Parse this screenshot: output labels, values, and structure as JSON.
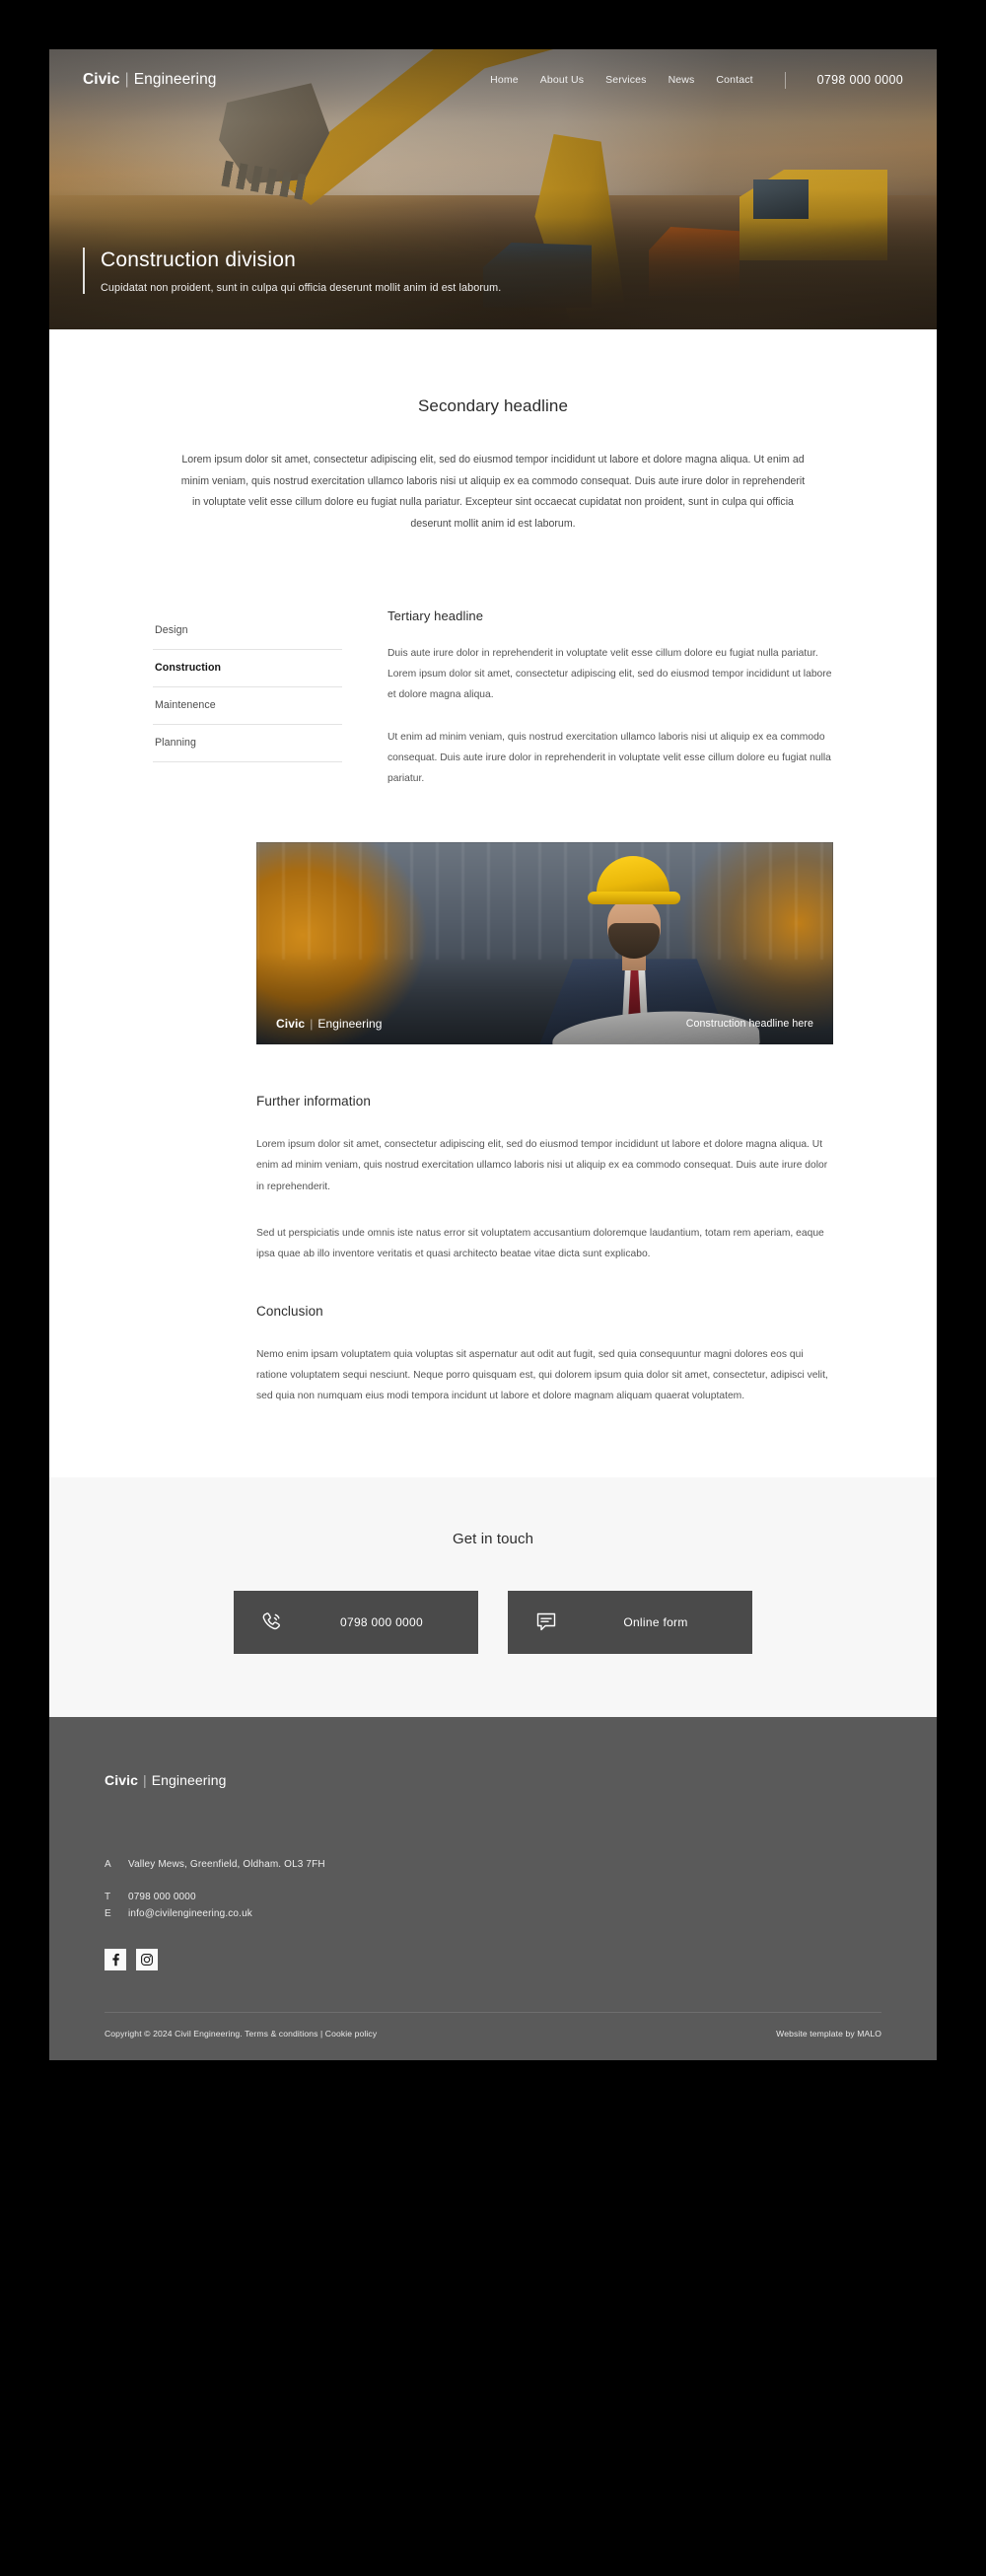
{
  "brand": {
    "first": "Civic",
    "divider": "|",
    "second": "Engineering"
  },
  "nav": {
    "items": [
      {
        "label": "Home"
      },
      {
        "label": "About Us"
      },
      {
        "label": "Services"
      },
      {
        "label": "News"
      },
      {
        "label": "Contact"
      }
    ],
    "phone": "0798 000 0000"
  },
  "hero": {
    "title": "Construction division",
    "subtitle": "Cupidatat non proident, sunt in culpa qui officia deserunt mollit anim id est laborum."
  },
  "secondary": {
    "headline": "Secondary headline",
    "intro": "Lorem ipsum dolor sit amet, consectetur adipiscing elit, sed do eiusmod tempor incididunt ut labore et dolore magna aliqua. Ut enim ad minim veniam, quis nostrud exercitation ullamco laboris nisi ut aliquip ex ea commodo consequat. Duis aute irure dolor in reprehenderit in voluptate velit esse cillum dolore eu fugiat nulla pariatur. Excepteur sint occaecat cupidatat non proident, sunt in culpa qui officia deserunt mollit anim id est laborum."
  },
  "sidebar": {
    "items": [
      {
        "label": "Design",
        "active": false
      },
      {
        "label": "Construction",
        "active": true
      },
      {
        "label": "Maintenence",
        "active": false
      },
      {
        "label": "Planning",
        "active": false
      }
    ]
  },
  "tertiary": {
    "headline": "Tertiary headline",
    "paragraph1": "Duis aute irure dolor in reprehenderit in voluptate velit esse cillum dolore eu fugiat nulla pariatur. Lorem ipsum dolor sit amet, consectetur adipiscing elit, sed do eiusmod tempor incididunt ut labore et dolore magna aliqua.",
    "paragraph2": "Ut enim ad minim veniam, quis nostrud exercitation ullamco laboris nisi ut aliquip ex ea commodo consequat. Duis aute irure dolor in reprehenderit in voluptate velit esse cillum dolore eu fugiat nulla pariatur."
  },
  "feature_image": {
    "caption": "Construction headline here"
  },
  "further": {
    "headline": "Further information",
    "paragraph1": "Lorem ipsum dolor sit amet, consectetur adipiscing elit, sed do eiusmod tempor incididunt ut labore et dolore magna aliqua. Ut enim ad minim veniam, quis nostrud exercitation ullamco laboris nisi ut aliquip ex ea commodo consequat. Duis aute irure dolor in reprehenderit.",
    "paragraph2": "Sed ut perspiciatis unde omnis iste natus error sit voluptatem accusantium doloremque laudantium, totam rem aperiam, eaque ipsa quae ab illo inventore veritatis et quasi architecto beatae vitae dicta sunt explicabo."
  },
  "conclusion": {
    "headline": "Conclusion",
    "paragraph1": "Nemo enim ipsam voluptatem quia voluptas sit aspernatur aut odit aut fugit, sed quia consequuntur magni dolores eos qui ratione voluptatem sequi nesciunt. Neque porro quisquam est, qui dolorem ipsum quia dolor sit amet, consectetur, adipisci velit, sed quia non numquam eius modi tempora incidunt ut labore et dolore magnam aliquam quaerat voluptatem."
  },
  "cta": {
    "headline": "Get in touch",
    "phone_label": "0798 000 0000",
    "phone_icon": "phone-icon",
    "form_label": "Online form",
    "form_icon": "chat-bubble-icon"
  },
  "footer": {
    "address_key": "A",
    "address": "Valley Mews, Greenfield, Oldham. OL3 7FH",
    "phone_key": "T",
    "phone": "0798 000 0000",
    "email_key": "E",
    "email": "info@civilengineering.co.uk",
    "socials": [
      {
        "name": "facebook-icon"
      },
      {
        "name": "instagram-icon"
      }
    ],
    "copyright": "Copyright © 2024 Civil Engineering.  Terms & conditions | Cookie policy",
    "credit": "Website template  by MALO"
  },
  "colors": {
    "page_bg": "#ffffff",
    "outer_bg": "#000000",
    "cta_bg": "#f7f7f7",
    "cta_button": "#4a4a4a",
    "footer_bg": "#5a5a5a",
    "text_dark": "#2c2c2c",
    "text_body": "#555555"
  }
}
